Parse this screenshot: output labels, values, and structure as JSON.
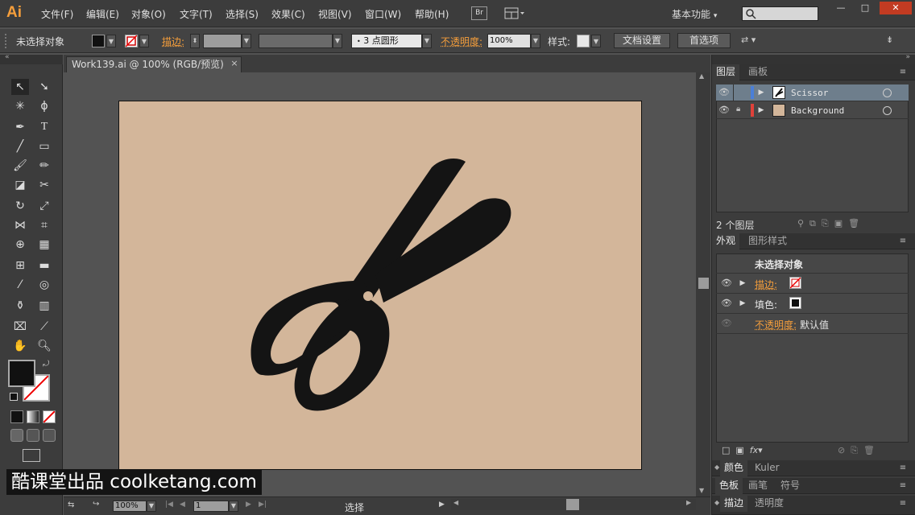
{
  "app": {
    "logo": "Ai"
  },
  "menu": [
    "文件(F)",
    "编辑(E)",
    "对象(O)",
    "文字(T)",
    "选择(S)",
    "效果(C)",
    "视图(V)",
    "窗口(W)",
    "帮助(H)"
  ],
  "bridge_label": "Br",
  "workspace": "基本功能",
  "window_controls": {
    "minimize": "—",
    "restore": "□",
    "close": "✕"
  },
  "control": {
    "selection": "未选择对象",
    "stroke_label": "描边:",
    "brush_value": "3 点圆形",
    "opacity_label": "不透明度:",
    "opacity_value": "100%",
    "style_label": "样式:",
    "doc_setup": "文档设置",
    "prefs": "首选项"
  },
  "document": {
    "tab_title": "Work139.ai @ 100% (RGB/预览)",
    "close": "×"
  },
  "status": {
    "zoom": "100%",
    "page": "1",
    "tool": "选择"
  },
  "layers_panel": {
    "tabs": [
      "图层",
      "画板"
    ],
    "layers": [
      {
        "name": "Scissor",
        "color": "#4a7fd8",
        "selected": true
      },
      {
        "name": "Background",
        "color": "#e0413a",
        "selected": false
      }
    ],
    "count": "2 个图层"
  },
  "appearance_panel": {
    "tabs": [
      "外观",
      "图形样式"
    ],
    "header": "未选择对象",
    "stroke_label": "描边:",
    "fill_label": "填色:",
    "opacity_label": "不透明度:",
    "opacity_value": "默认值"
  },
  "bottom_panels": [
    [
      "颜色",
      "Kuler"
    ],
    [
      "色板",
      "画笔",
      "符号"
    ],
    [
      "描边",
      "透明度"
    ]
  ],
  "brand": "酷课堂出品 coolketang.com",
  "colors": {
    "artboard": "#d3b69a",
    "accent": "#f59e3b",
    "scissor": "#141414"
  }
}
